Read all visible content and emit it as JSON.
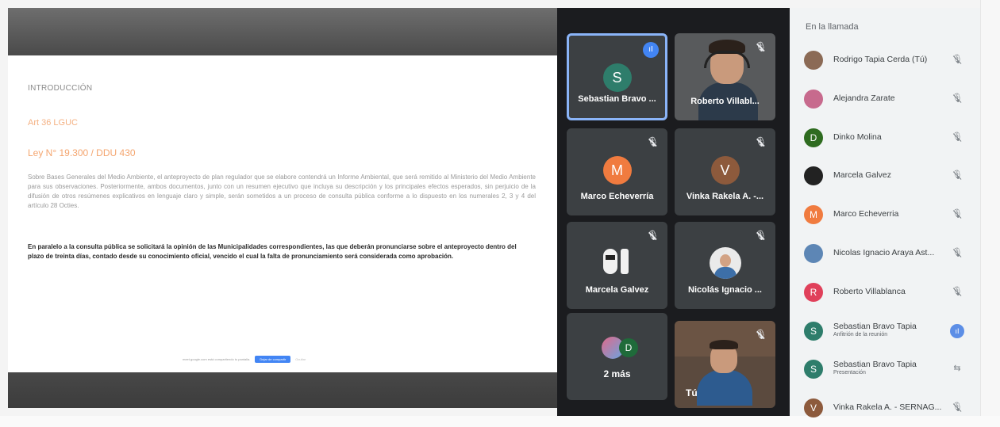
{
  "slide": {
    "intro": "INTRODUCCIÓN",
    "art": "Art 36 LGUC",
    "ley": "Ley N° 19.300 / DDU 430",
    "paragraph1": "Sobre Bases Generales del Medio Ambiente, el anteproyecto de plan regulador que se elabore contendrá un Informe Ambiental, que será remitido al Ministerio del Medio Ambiente para sus observaciones. Posteriormente, ambos documentos, junto con un resumen ejecutivo que incluya su descripción y los principales efectos esperados, sin perjuicio de la difusión de otros resúmenes explicativos en lenguaje claro y simple, serán sometidos a un proceso de consulta pública conforme a lo dispuesto en los numerales 2, 3 y 4 del artículo 28 Octies.",
    "paragraph2": "En paralelo a la consulta pública se solicitará la opinión de las Municipalidades correspondientes, las que deberán pronunciarse sobre el anteproyecto dentro del plazo de treinta días, contado desde su conocimiento oficial, vencido el cual la falta de pronunciamiento será considerada como aprobación.",
    "share_text": "meet.google.com está compartiendo tu pantalla.",
    "share_button": "Dejar de compartir",
    "share_hide": "Ocultar"
  },
  "tiles": {
    "t1": {
      "name": "Sebastian Bravo ...",
      "initial": "S",
      "color": "#2e7d6b"
    },
    "t2": {
      "name": "Roberto Villabl..."
    },
    "t3": {
      "name": "Marco Echeverría",
      "initial": "M",
      "color": "#f07b3f"
    },
    "t4": {
      "name": "Vinka Rakela A. -...",
      "initial": "V",
      "color": "#8d5a3c"
    },
    "t5": {
      "name": "Marcela Galvez"
    },
    "t6": {
      "name": "Nicolás Ignacio ..."
    },
    "t7": {
      "name": "2 más",
      "badge": "D"
    },
    "t8": {
      "name": "Tú"
    }
  },
  "panel": {
    "title": "En la llamada",
    "participants": [
      {
        "name": "Rodrigo Tapia Cerda (Tú)",
        "sub": "",
        "initial": "",
        "color": "#8b6a55"
      },
      {
        "name": "Alejandra Zarate",
        "sub": "",
        "initial": "",
        "color": "#c76a8d"
      },
      {
        "name": "Dinko Molina",
        "sub": "",
        "initial": "D",
        "color": "#2e6b1f"
      },
      {
        "name": "Marcela Galvez",
        "sub": "",
        "initial": "",
        "color": "#222222"
      },
      {
        "name": "Marco Echeverria",
        "sub": "",
        "initial": "M",
        "color": "#f07b3f"
      },
      {
        "name": "Nicolas Ignacio Araya Ast...",
        "sub": "",
        "initial": "",
        "color": "#5d86b5"
      },
      {
        "name": "Roberto Villablanca",
        "sub": "",
        "initial": "R",
        "color": "#e0405a"
      },
      {
        "name": "Sebastian Bravo Tapia",
        "sub": "Anfitrión de la reunión",
        "initial": "S",
        "color": "#2e7d6b"
      },
      {
        "name": "Sebastian Bravo Tapia",
        "sub": "Presentación",
        "initial": "S",
        "color": "#2e7d6b"
      },
      {
        "name": "Vinka Rakela A. - SERNAG...",
        "sub": "",
        "initial": "V",
        "color": "#8d5a3c"
      }
    ]
  }
}
